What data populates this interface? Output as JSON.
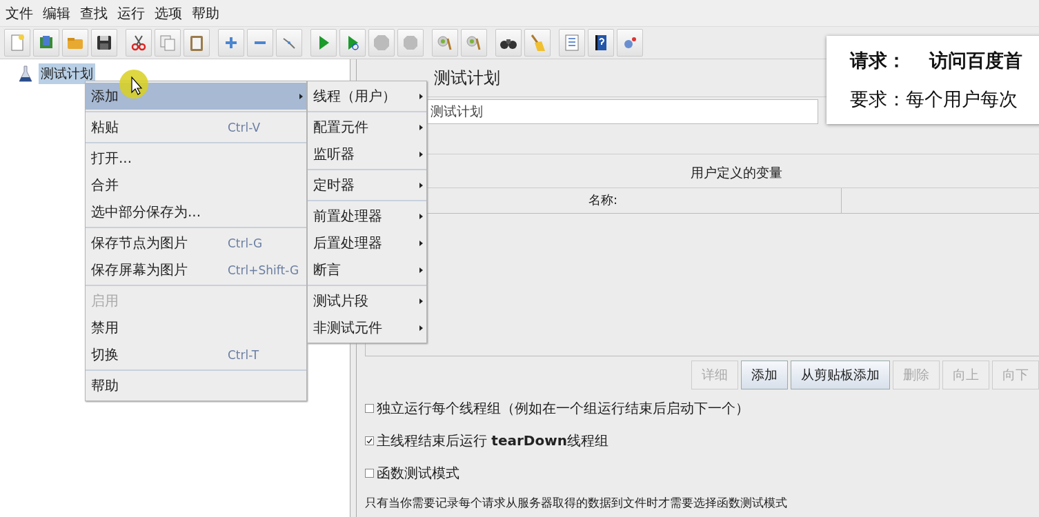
{
  "menu_bar": [
    "文件",
    "编辑",
    "查找",
    "运行",
    "选项",
    "帮助"
  ],
  "tree": {
    "label": "测试计划",
    "selected": true
  },
  "context_menu": {
    "groups": [
      [
        {
          "label": "添加",
          "disabled": false,
          "selected": true,
          "submenu": true
        }
      ],
      [
        {
          "label": "粘贴",
          "shortcut": "Ctrl-V",
          "disabled": false,
          "selected": false,
          "submenu": false
        }
      ],
      [
        {
          "label": "打开...",
          "disabled": false,
          "selected": false,
          "submenu": false
        },
        {
          "label": "合并",
          "disabled": false,
          "selected": false,
          "submenu": false
        },
        {
          "label": "选中部分保存为...",
          "disabled": false,
          "selected": false,
          "submenu": false
        }
      ],
      [
        {
          "label": "保存节点为图片",
          "shortcut": "Ctrl-G",
          "disabled": false,
          "selected": false,
          "submenu": false
        },
        {
          "label": "保存屏幕为图片",
          "shortcut": "Ctrl+Shift-G",
          "disabled": false,
          "selected": false,
          "submenu": false
        }
      ],
      [
        {
          "label": "启用",
          "disabled": true,
          "selected": false,
          "submenu": false
        },
        {
          "label": "禁用",
          "disabled": false,
          "selected": false,
          "submenu": false
        },
        {
          "label": "切换",
          "shortcut": "Ctrl-T",
          "disabled": false,
          "selected": false,
          "submenu": false
        }
      ],
      [
        {
          "label": "帮助",
          "disabled": false,
          "selected": false,
          "submenu": false
        }
      ]
    ]
  },
  "submenu": {
    "groups": [
      [
        {
          "label": "线程（用户）"
        }
      ],
      [
        {
          "label": "配置元件"
        },
        {
          "label": "监听器"
        }
      ],
      [
        {
          "label": "定时器"
        }
      ],
      [
        {
          "label": "前置处理器"
        },
        {
          "label": "后置处理器"
        },
        {
          "label": "断言"
        }
      ],
      [
        {
          "label": "测试片段"
        },
        {
          "label": "非测试元件"
        }
      ]
    ]
  },
  "panel": {
    "title": "测试计划",
    "name_value": "测试计划",
    "variables_title": "用户定义的变量",
    "columns": [
      "名称:"
    ],
    "buttons": [
      {
        "label": "详细",
        "disabled": true
      },
      {
        "label": "添加",
        "disabled": false
      },
      {
        "label": "从剪贴板添加",
        "disabled": false
      },
      {
        "label": "删除",
        "disabled": true
      },
      {
        "label": "向上",
        "disabled": true
      },
      {
        "label": "向下",
        "disabled": true
      }
    ],
    "options": [
      {
        "label": "独立运行每个线程组（例如在一个组运行结束后启动下一个）",
        "checked": false
      },
      {
        "label": "主线程结束后运行 **tearDown**线程组",
        "checked": true
      },
      {
        "label": "函数测试模式",
        "checked": false
      }
    ],
    "note": "只有当你需要记录每个请求从服务器取得的数据到文件时才需要选择函数测试模式"
  },
  "overlay_note": {
    "line_1_label": "请求：",
    "line_1_value": "访问百度首",
    "line_2": "要求：每个用户每次"
  }
}
